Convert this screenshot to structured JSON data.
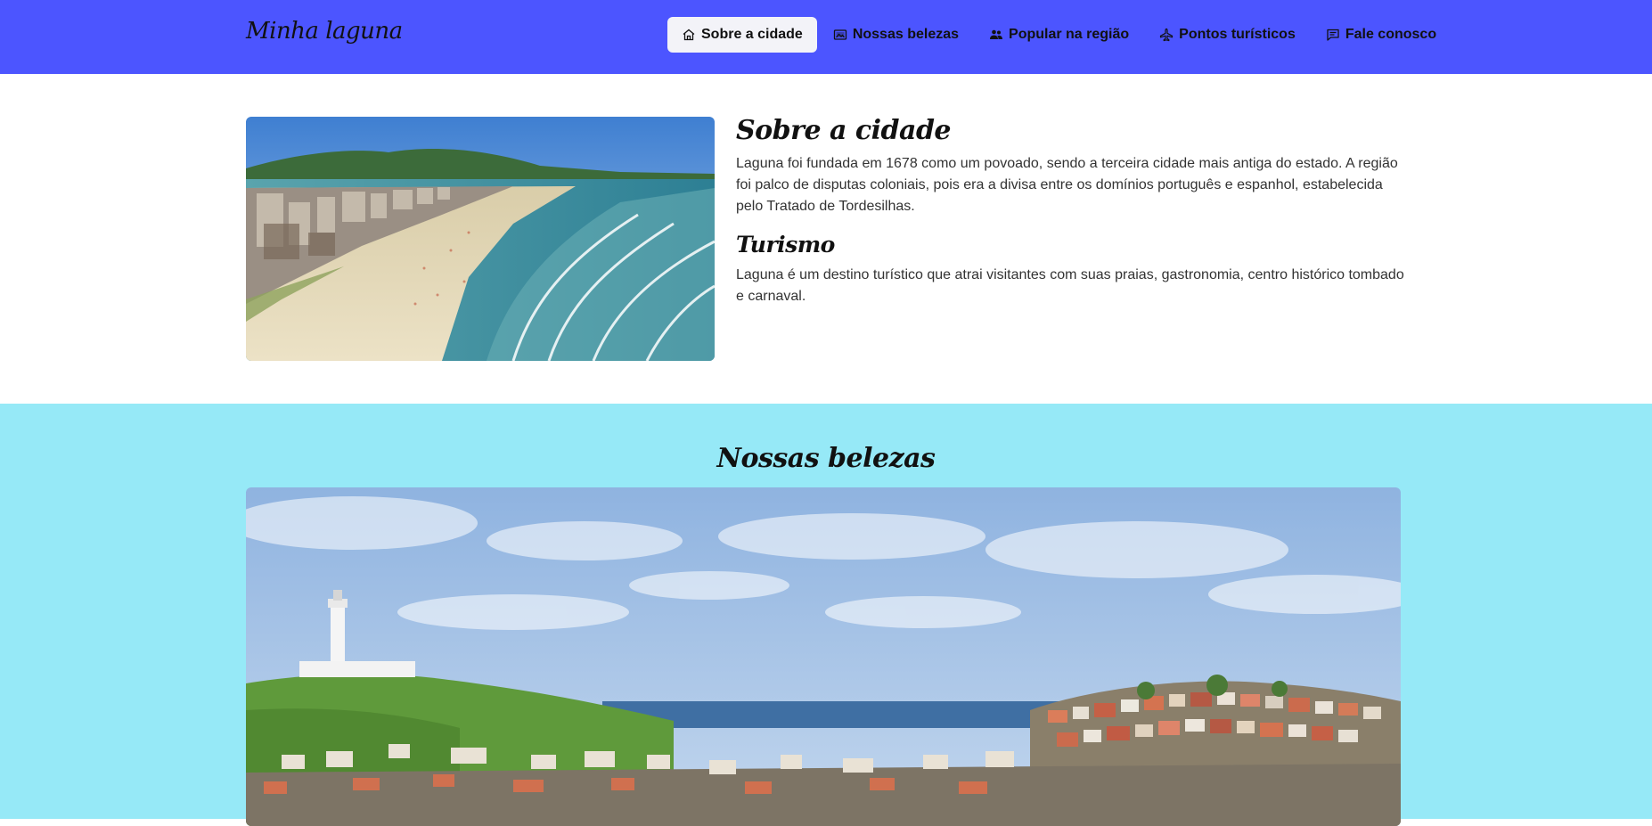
{
  "navbar": {
    "brand": "Minha laguna",
    "items": [
      {
        "label": "Sobre a cidade",
        "icon": "home-icon",
        "active": true
      },
      {
        "label": "Nossas belezas",
        "icon": "image-icon",
        "active": false
      },
      {
        "label": "Popular na região",
        "icon": "people-icon",
        "active": false
      },
      {
        "label": "Pontos turísticos",
        "icon": "airplane-icon",
        "active": false
      },
      {
        "label": "Fale conosco",
        "icon": "chat-icon",
        "active": false
      }
    ]
  },
  "about": {
    "title": "Sobre a cidade",
    "paragraph": "Laguna foi fundada em 1678 como um povoado, sendo a terceira cidade mais antiga do estado. A região foi palco de disputas coloniais, pois era a divisa entre os domínios português e espanhol, estabelecida pelo Tratado de Tordesilhas.",
    "tourism_title": "Turismo",
    "tourism_paragraph": "Laguna é um destino turístico que atrai visitantes com suas praias, gastronomia, centro histórico tombado e carnaval."
  },
  "beauties": {
    "title": "Nossas belezas"
  },
  "colors": {
    "navbar_bg": "#4c55ff",
    "beauties_bg": "#96e9f7",
    "active_tab_bg": "#f3f3f8"
  }
}
